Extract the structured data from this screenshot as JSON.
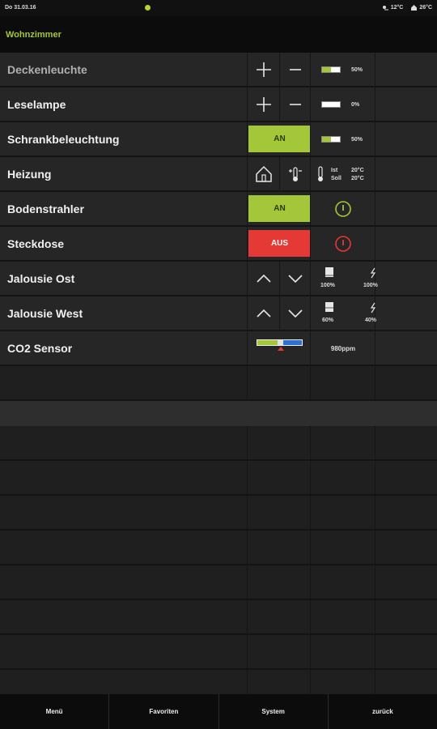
{
  "status": {
    "date": "Do 31.03.16",
    "indicator_color": "#b7d432",
    "outdoor_temp": "12°C",
    "indoor_temp": "26°C"
  },
  "header": {
    "title": "Wohnzimmer"
  },
  "rows": [
    {
      "label": "Deckenleuchte",
      "type": "dimmer",
      "percent_text": "50%",
      "level": 0.5
    },
    {
      "label": "Leselampe",
      "type": "dimmer",
      "percent_text": "0%",
      "level": 0.0
    },
    {
      "label": "Schrankbeleuchtung",
      "type": "switch-dimmer",
      "state_label": "AN",
      "percent_text": "50%",
      "level": 0.5
    },
    {
      "label": "Heizung",
      "type": "heating",
      "ist_label": "Ist",
      "ist_value": "20°C",
      "soll_label": "Soll",
      "soll_value": "20°C"
    },
    {
      "label": "Bodenstrahler",
      "type": "switch",
      "state_label": "AN"
    },
    {
      "label": "Steckdose",
      "type": "switch",
      "state_label": "AUS"
    },
    {
      "label": "Jalousie Ost",
      "type": "blind",
      "position_text": "100%",
      "angle_text": "100%"
    },
    {
      "label": "Jalousie West",
      "type": "blind",
      "position_text": "60%",
      "angle_text": "40%"
    },
    {
      "label": "CO2 Sensor",
      "type": "sensor",
      "value_text": "980ppm"
    }
  ],
  "colors": {
    "accent": "#a4c639",
    "alert": "#e53935",
    "info": "#2e6fd6"
  },
  "footer": {
    "menu": "Menü",
    "favorites": "Favoriten",
    "system": "System",
    "back": "zurück"
  }
}
